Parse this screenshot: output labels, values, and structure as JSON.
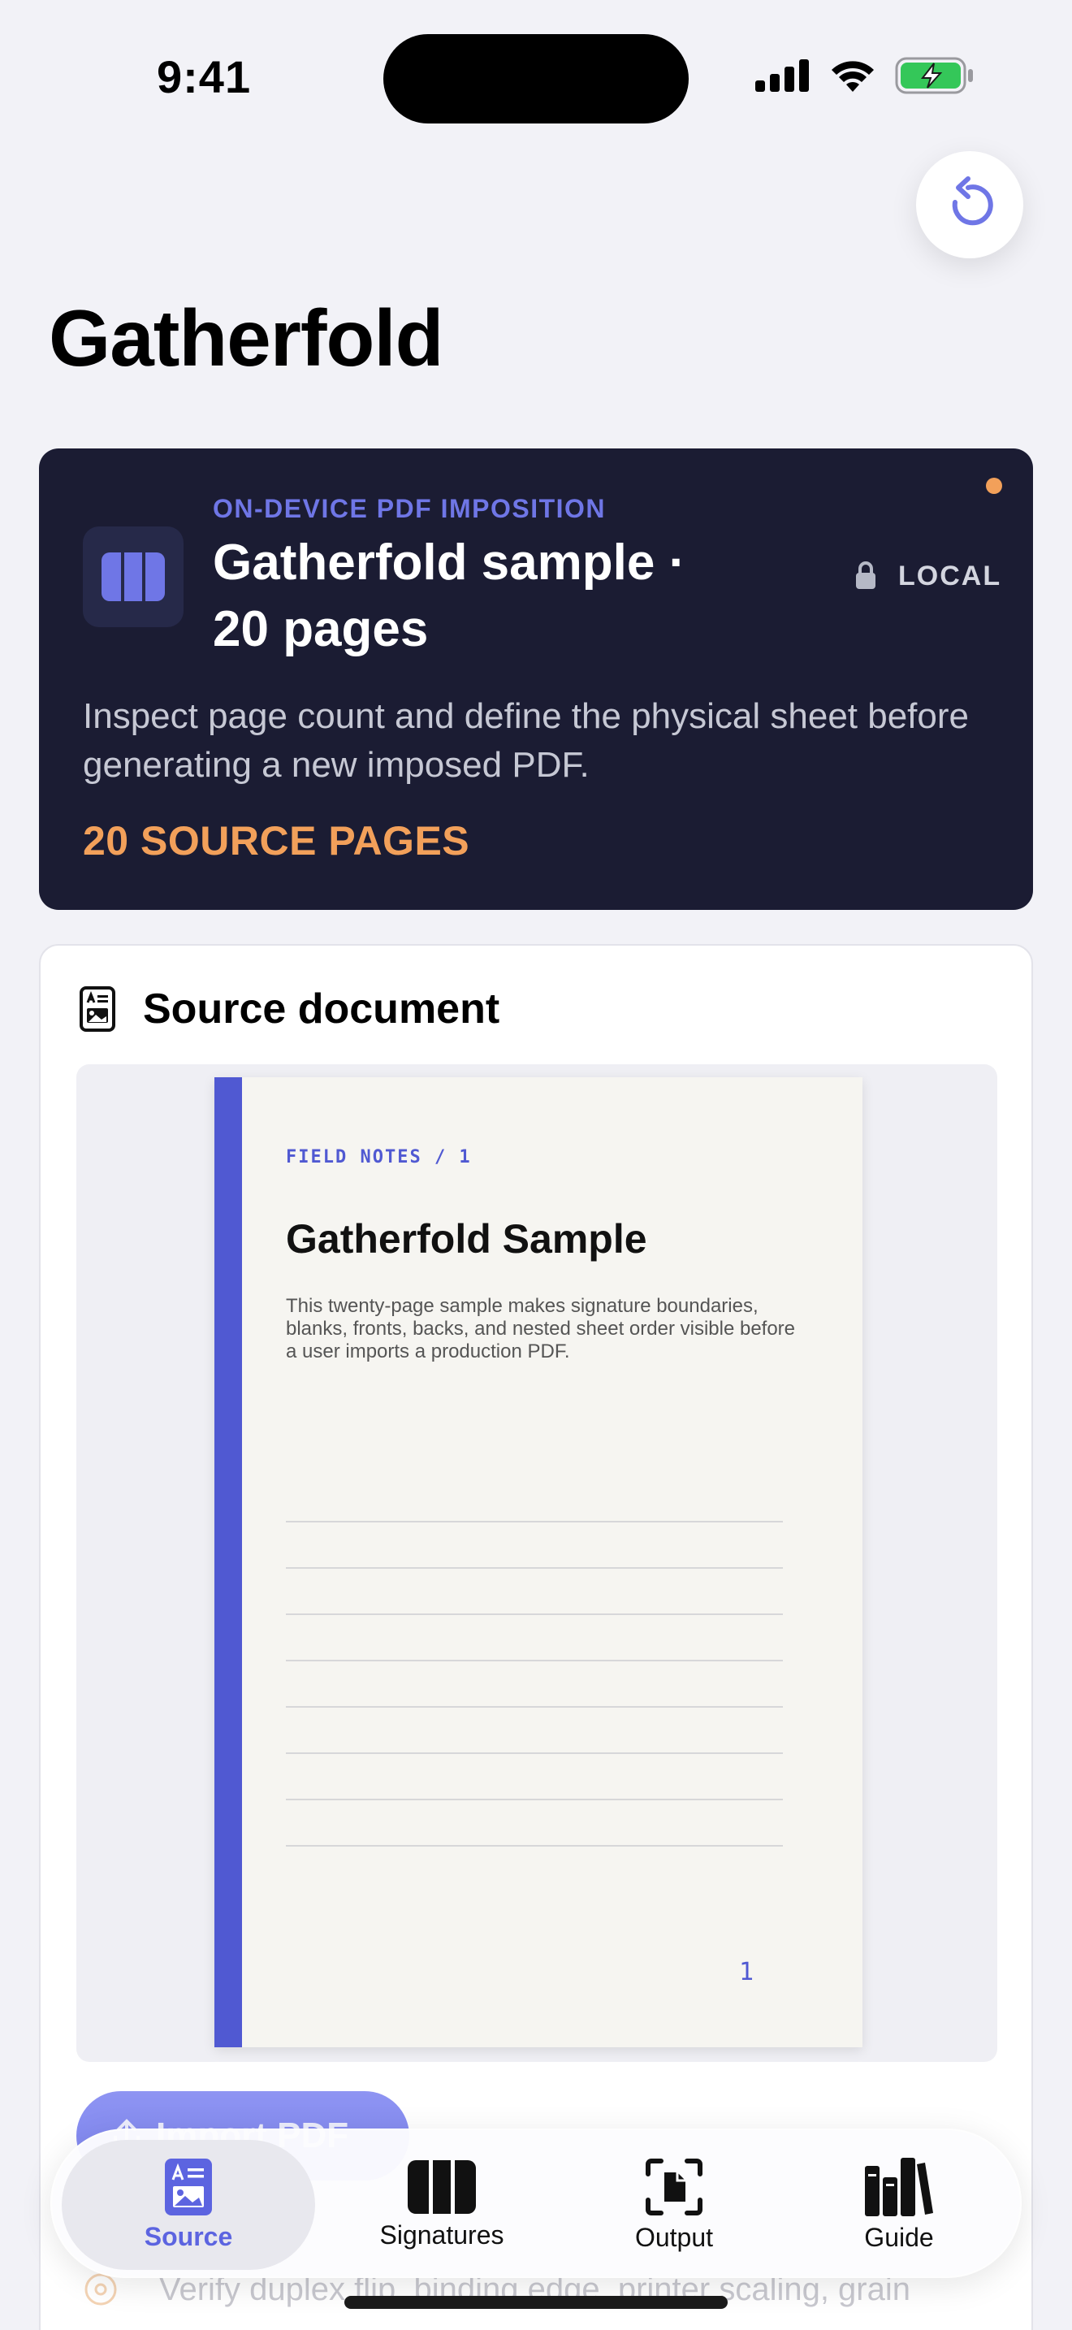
{
  "status_bar": {
    "time": "9:41"
  },
  "header": {
    "title": "Gatherfold"
  },
  "hero": {
    "eyebrow": "ON-DEVICE PDF IMPOSITION",
    "title": "Gatherfold sample · 20 pages",
    "badge": "LOCAL",
    "description": "Inspect page count and define the physical sheet before generating a new imposed PDF.",
    "stat": "20 SOURCE PAGES"
  },
  "source_card": {
    "title": "Source document",
    "preview": {
      "eyebrow": "FIELD NOTES / 1",
      "title": "Gatherfold Sample",
      "body": "This twenty-page sample makes signature boundaries, blanks, fronts, backs, and nested sheet order visible before a user imports a production PDF.",
      "page_number": "1"
    },
    "import_button": "Import PDF",
    "checklist_item": "Verify duplex flip, binding edge, printer scaling, grain"
  },
  "tabs": [
    {
      "label": "Source",
      "icon": "document-photo-icon",
      "active": true
    },
    {
      "label": "Signatures",
      "icon": "columns-icon",
      "active": false
    },
    {
      "label": "Output",
      "icon": "doc-viewfinder-icon",
      "active": false
    },
    {
      "label": "Guide",
      "icon": "books-icon",
      "active": false
    }
  ],
  "colors": {
    "accent": "#5C64E0",
    "hero_bg": "#1B1C33",
    "hero_accent": "#F2A05A",
    "page_bg": "#F2F2F7"
  }
}
